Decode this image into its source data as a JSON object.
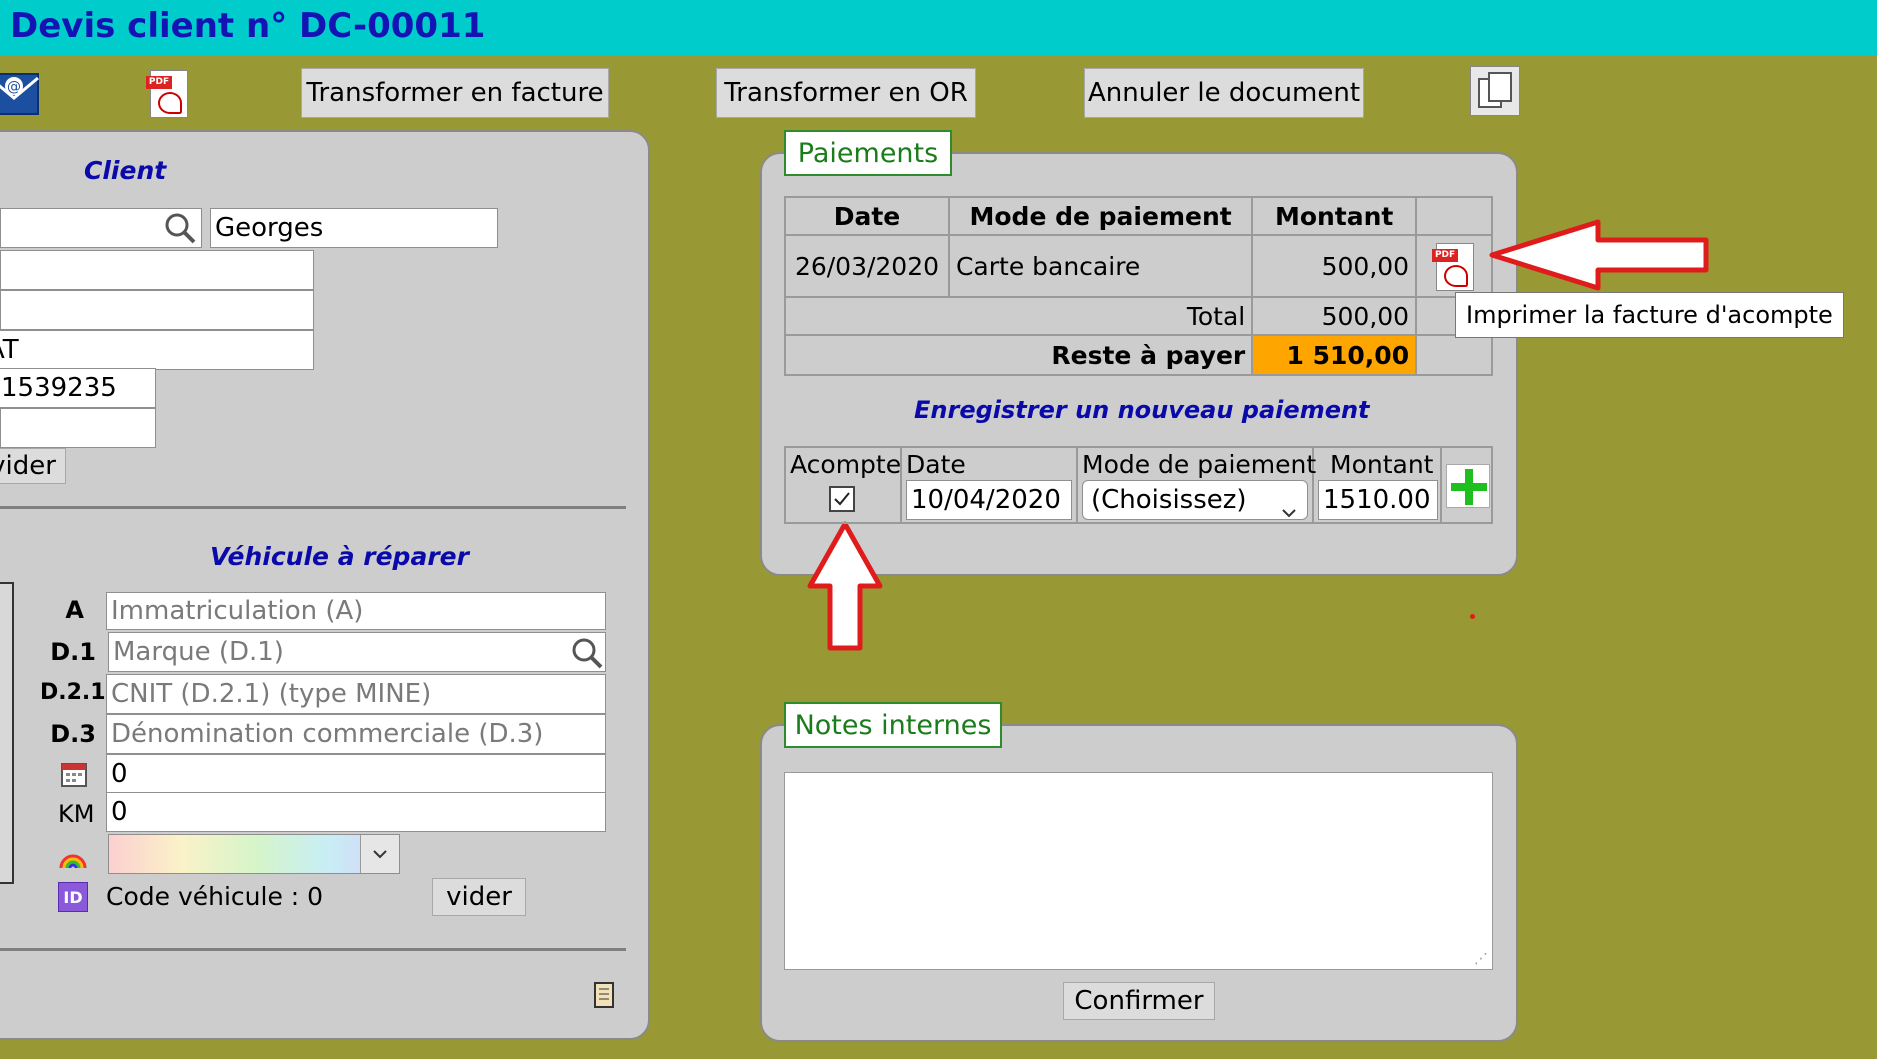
{
  "window": {
    "title": "Devis client n° DC-00011"
  },
  "toolbar": {
    "transform_invoice": "Transformer en facture",
    "transform_or": "Transformer en OR",
    "cancel_doc": "Annuler le document"
  },
  "client": {
    "section_title": "Client",
    "first_name": "Georges",
    "field_at": "AT",
    "field_phone": "1539235",
    "clear_label": "vider"
  },
  "vehicle": {
    "section_title": "Véhicule à réparer",
    "rows": [
      {
        "label": "A",
        "placeholder": "Immatriculation (A)"
      },
      {
        "label": "D.1",
        "placeholder": "Marque (D.1)"
      },
      {
        "label": "D.2.1",
        "placeholder": "CNIT (D.2.1) (type MINE)"
      },
      {
        "label": "D.3",
        "placeholder": "Dénomination commerciale (D.3)"
      }
    ],
    "date_value": "0",
    "km_label": "KM",
    "km_value": "0",
    "code_label": "Code véhicule :",
    "code_value": "0",
    "clear_label": "vider"
  },
  "payments": {
    "tab_label": "Paiements",
    "headers": {
      "date": "Date",
      "mode": "Mode de paiement",
      "amount": "Montant"
    },
    "rows": [
      {
        "date": "26/03/2020",
        "mode": "Carte bancaire",
        "amount": "500,00"
      }
    ],
    "total_label": "Total",
    "total_value": "500,00",
    "remaining_label": "Reste à payer",
    "remaining_value": "1 510,00",
    "tooltip": "Imprimer la facture d'acompte",
    "new_payment_title": "Enregistrer un nouveau paiement",
    "new": {
      "deposit_label": "Acompte",
      "date_label": "Date",
      "date_value": "10/04/2020",
      "mode_label": "Mode de paiement",
      "mode_value": "(Choisissez)",
      "amount_label": "Montant",
      "amount_value": "1510.00"
    }
  },
  "notes": {
    "tab_label": "Notes internes",
    "confirm_label": "Confirmer"
  },
  "colors": {
    "titlebar": "#00cccc",
    "background": "#989834",
    "remaining_highlight": "#ffa500",
    "section_title": "#0a0aaa",
    "tab_text": "#1b7c1b"
  }
}
